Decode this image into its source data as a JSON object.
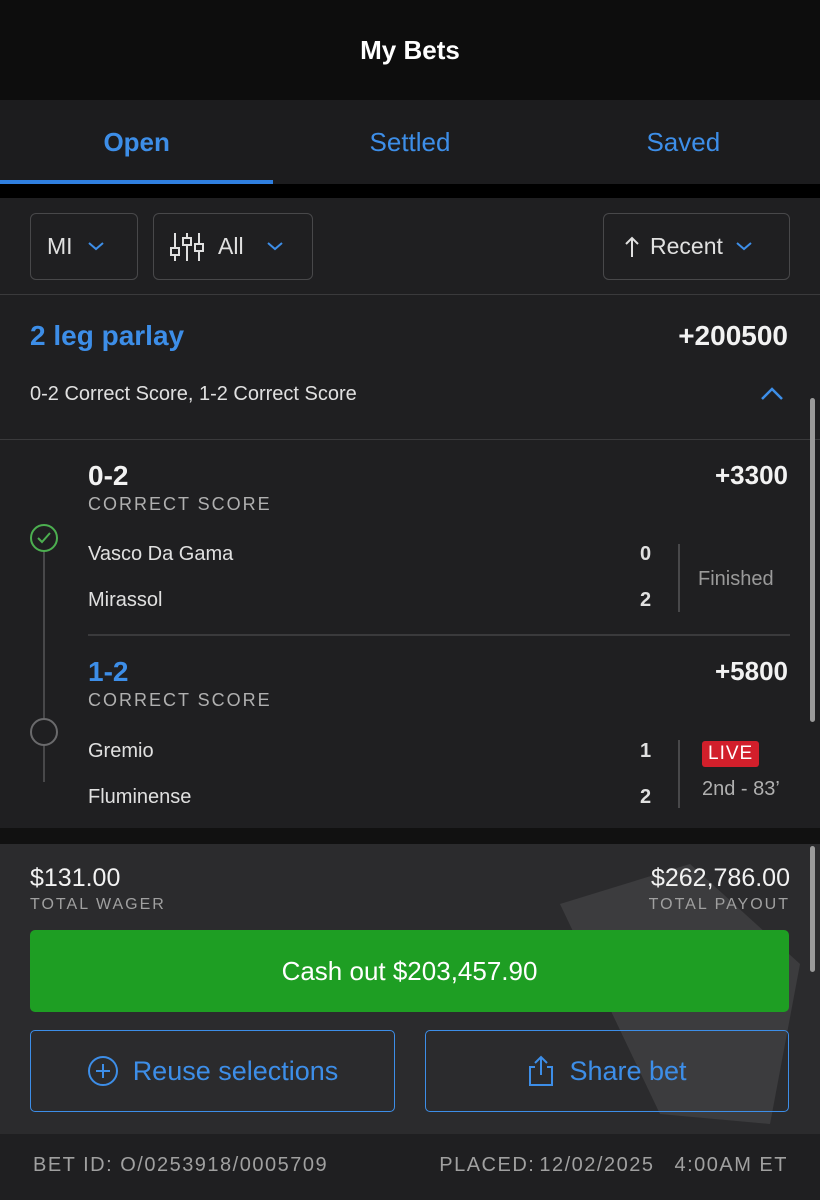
{
  "header": {
    "title": "My Bets"
  },
  "tabs": [
    {
      "label": "Open",
      "active": true
    },
    {
      "label": "Settled",
      "active": false
    },
    {
      "label": "Saved",
      "active": false
    }
  ],
  "filters": {
    "state": "MI",
    "type": "All",
    "sort": "Recent"
  },
  "parlay": {
    "title": "2 leg parlay",
    "odds": "+200500",
    "description": "0-2 Correct Score, 1-2 Correct Score",
    "legs": [
      {
        "selection": "0-2",
        "market": "CORRECT SCORE",
        "odds": "+3300",
        "home_team": "Vasco Da Gama",
        "home_score": "0",
        "away_team": "Mirassol",
        "away_score": "2",
        "status": "Finished",
        "result": "won"
      },
      {
        "selection": "1-2",
        "market": "CORRECT SCORE",
        "odds": "+5800",
        "home_team": "Gremio",
        "home_score": "1",
        "away_team": "Fluminense",
        "away_score": "2",
        "live_badge": "LIVE",
        "clock": "2nd - 83’"
      }
    ]
  },
  "footer": {
    "total_wager": "$131.00",
    "total_wager_label": "TOTAL WAGER",
    "total_payout": "$262,786.00",
    "total_payout_label": "TOTAL PAYOUT",
    "cashout_label": "Cash out $203,457.90",
    "reuse_label": "Reuse selections",
    "share_label": "Share bet"
  },
  "meta": {
    "bet_id": "BET ID: O/0253918/0005709",
    "placed_label": "PLACED:",
    "placed_date": "12/02/2025",
    "placed_time": "4:00AM ET"
  },
  "colors": {
    "accent": "#3d8ee8",
    "cashout": "#1e9e23",
    "live": "#d21f2b",
    "won": "#4caf50"
  }
}
